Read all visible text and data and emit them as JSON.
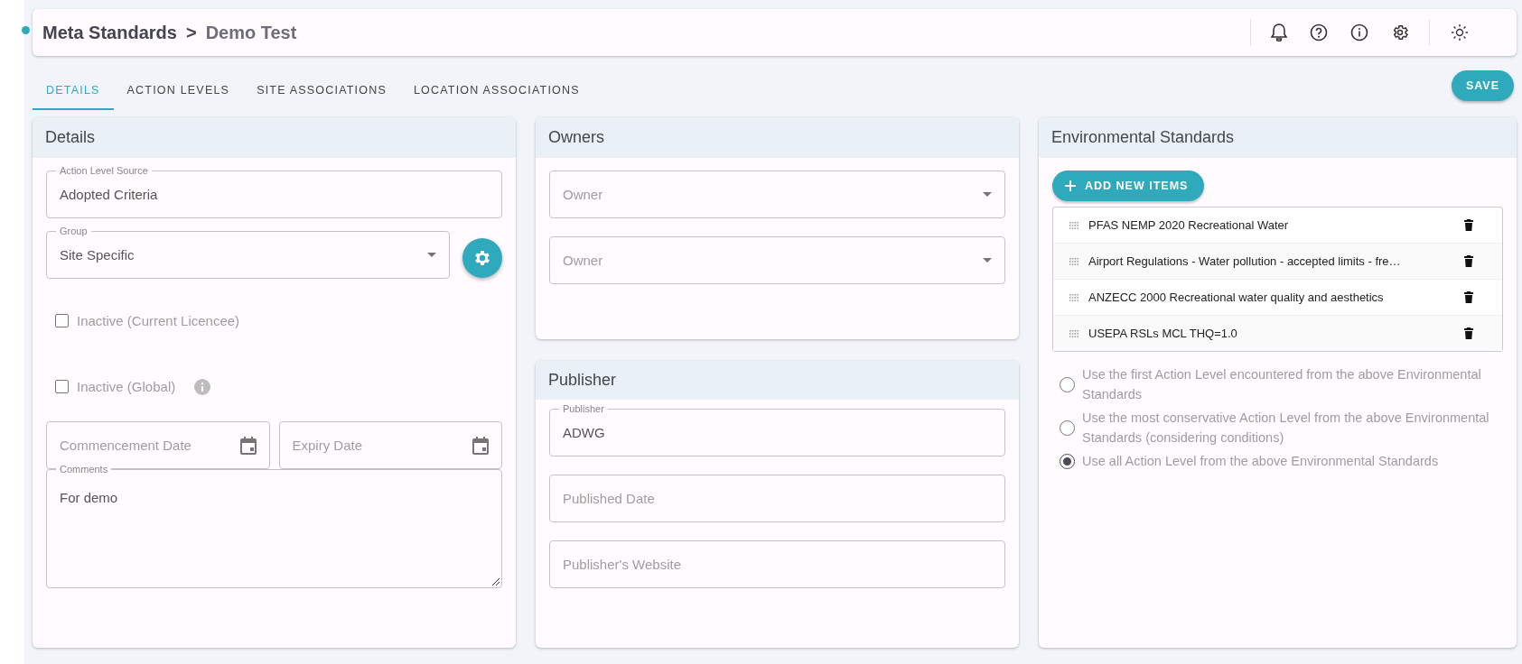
{
  "header": {
    "breadcrumb": "Meta Standards",
    "separator": ">",
    "title": "Demo Test"
  },
  "tabs": [
    {
      "label": "DETAILS",
      "selected": true
    },
    {
      "label": "ACTION LEVELS",
      "selected": false
    },
    {
      "label": "SITE ASSOCIATIONS",
      "selected": false
    },
    {
      "label": "LOCATION ASSOCIATIONS",
      "selected": false
    }
  ],
  "save_button": "SAVE",
  "details": {
    "title": "Details",
    "action_level_source": {
      "kind": "text",
      "label": "Action Level Source",
      "value": "Adopted Criteria"
    },
    "group": {
      "kind": "select",
      "label": "Group",
      "value": "Site Specific"
    },
    "checkboxes": [
      {
        "label": "Inactive (Current Licencee)",
        "checked": false,
        "info": false
      },
      {
        "label": "Inactive (Global)",
        "checked": false,
        "info": true
      }
    ],
    "dates": [
      {
        "kind": "date",
        "placeholder": "Commencement Date"
      },
      {
        "kind": "date",
        "placeholder": "Expiry Date"
      }
    ],
    "comments": {
      "kind": "textarea",
      "label": "Comments",
      "value": "For demo"
    }
  },
  "owners": {
    "title": "Owners",
    "fields": [
      {
        "kind": "select",
        "placeholder": "Owner"
      },
      {
        "kind": "select",
        "placeholder": "Owner"
      }
    ]
  },
  "publisher": {
    "title": "Publisher",
    "fields": [
      {
        "kind": "text",
        "label": "Publisher",
        "value": "ADWG"
      },
      {
        "kind": "text",
        "placeholder": "Published Date"
      },
      {
        "kind": "text",
        "placeholder": "Publisher's Website"
      }
    ]
  },
  "environmental_standards": {
    "title": "Environmental Standards",
    "add_button": "ADD NEW ITEMS",
    "items": [
      "PFAS NEMP 2020 Recreational Water",
      "Airport Regulations - Water pollution - accepted limits - fre…",
      "ANZECC 2000 Recreational water quality and aesthetics",
      "USEPA RSLs MCL THQ=1.0"
    ],
    "options": [
      {
        "label": "Use the first Action Level encountered from the above Environmental Standards",
        "selected": false
      },
      {
        "label": "Use the most conservative Action Level from the above Environmental Standards (considering conditions)",
        "selected": false
      },
      {
        "label": "Use all Action Level from the above Environmental Standards",
        "selected": true
      }
    ]
  }
}
